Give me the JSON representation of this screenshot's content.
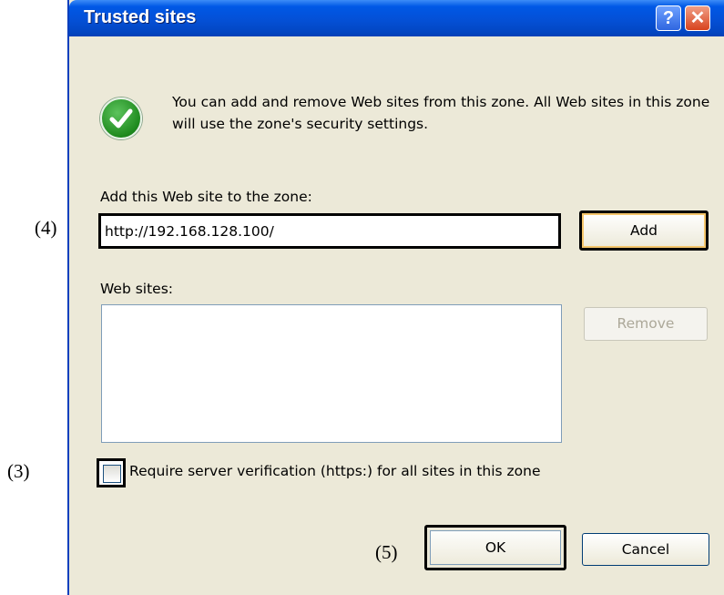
{
  "annotations": {
    "a4": "(4)",
    "a3": "(3)",
    "a5": "(5)"
  },
  "dialog": {
    "title": "Trusted sites",
    "help_glyph": "?",
    "close_glyph": "✕",
    "icon": "green-check-shield-icon",
    "message": "You can add and remove Web sites from this zone. All Web sites in this zone will use the zone's security settings.",
    "add_label": "Add this Web site to the zone:",
    "url_value": "http://192.168.128.100/",
    "add_button": "Add",
    "websites_label": "Web sites:",
    "websites": [],
    "remove_button": "Remove",
    "require_https_label": "Require server verification (https:) for all sites in this zone",
    "require_https_checked": false,
    "ok_button": "OK",
    "cancel_button": "Cancel"
  },
  "colors": {
    "titlebar": "#0450d6",
    "face": "#ece9d8",
    "close": "#d8431e",
    "check": "#1e8a1e"
  }
}
